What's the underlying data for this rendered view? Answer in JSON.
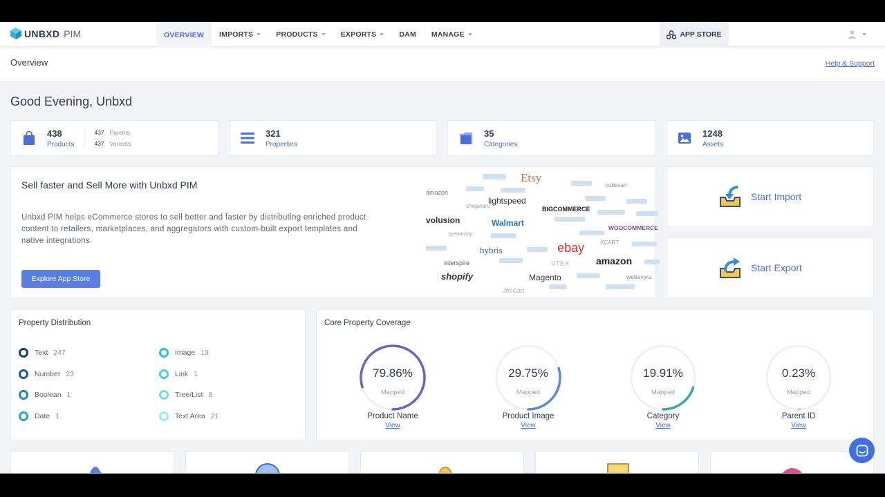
{
  "brand": {
    "name": "UNBXD",
    "product": "PIM"
  },
  "nav": {
    "items": [
      {
        "label": "OVERVIEW",
        "active": true,
        "dropdown": false
      },
      {
        "label": "IMPORTS",
        "active": false,
        "dropdown": true
      },
      {
        "label": "PRODUCTS",
        "active": false,
        "dropdown": true
      },
      {
        "label": "EXPORTS",
        "active": false,
        "dropdown": true
      },
      {
        "label": "DAM",
        "active": false,
        "dropdown": false
      },
      {
        "label": "MANAGE",
        "active": false,
        "dropdown": true
      }
    ],
    "app_store": "APP STORE"
  },
  "header": {
    "title": "Overview",
    "help": "Help & Support"
  },
  "greeting": "Good Evening, Unbxd",
  "stats": [
    {
      "icon": "shopping-bag-icon",
      "value": "438",
      "label": "Products",
      "parents_value": "437",
      "parents_label": "Parents",
      "variants_value": "437",
      "variants_label": "Variants"
    },
    {
      "icon": "list-icon",
      "value": "321",
      "label": "Properties"
    },
    {
      "icon": "folder-icon",
      "value": "35",
      "label": "Categories"
    },
    {
      "icon": "image-icon",
      "value": "1248",
      "label": "Assets"
    }
  ],
  "promo": {
    "title": "Sell faster and Sell More with Unbxd PIM",
    "body": "Unbxd PIM helps eCommerce stores to sell better and faster by distributing enriched product content to retailers, marketplaces, and aggregators with custom-built export templates and native integrations.",
    "button": "Explore App Store",
    "logos": [
      "Etsy",
      "amazon",
      "lightspeed",
      "BIGCOMMERCE",
      "volusion",
      "Walmart",
      "WOOCOMMERCE",
      "hybris",
      "ebay",
      "XCART",
      "amazon",
      "interspire",
      "shopify",
      "Magento",
      "webavyra",
      "JooCart",
      "cubecart",
      "shopware",
      "prestashop",
      "VTEX"
    ]
  },
  "actions": {
    "import": "Start Import",
    "export": "Start Export"
  },
  "distribution": {
    "title": "Property Distribution",
    "items": [
      {
        "label": "Text",
        "count": "247",
        "color": "#17406e"
      },
      {
        "label": "Number",
        "count": "23",
        "color": "#1d5b86"
      },
      {
        "label": "Boolean",
        "count": "1",
        "color": "#2489a8"
      },
      {
        "label": "Date",
        "count": "1",
        "color": "#27a7bf"
      },
      {
        "label": "Image",
        "count": "19",
        "color": "#2cc3cd"
      },
      {
        "label": "Link",
        "count": "1",
        "color": "#48d3d6"
      },
      {
        "label": "Tree/List",
        "count": "8",
        "color": "#6fe0e0"
      },
      {
        "label": "Text Area",
        "count": "21",
        "color": "#9cebeb"
      }
    ]
  },
  "coverage": {
    "title": "Core Property Coverage",
    "mapped_label": "Mapped",
    "view_label": "View",
    "items": [
      {
        "name": "Product Name",
        "percent": "79.86%",
        "value": 79.86,
        "color": "#6a63c9"
      },
      {
        "name": "Product Image",
        "percent": "29.75%",
        "value": 29.75,
        "color": "#5b8be0"
      },
      {
        "name": "Category",
        "percent": "19.91%",
        "value": 19.91,
        "color": "#3fa7a3"
      },
      {
        "name": "Parent ID",
        "percent": "0.23%",
        "value": 0.23,
        "color": "#c7cbd6"
      }
    ]
  },
  "colors": {
    "accent": "#4a6fd8",
    "button": "#5b7ee5",
    "chat": "#3f71e2"
  }
}
